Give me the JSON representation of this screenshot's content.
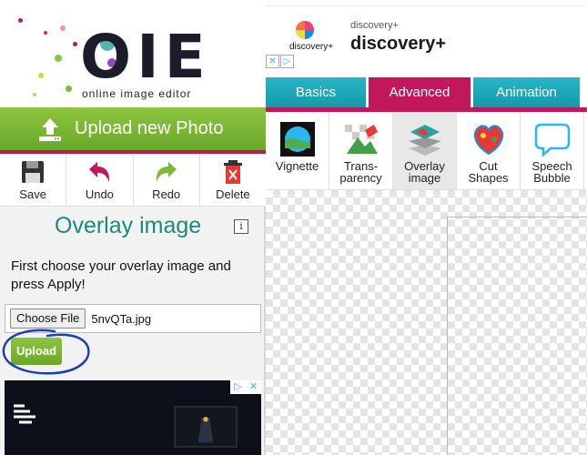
{
  "logo": {
    "letters": "OIE",
    "subtitle": "online image editor"
  },
  "upload_bar": {
    "label": "Upload new Photo"
  },
  "tools": {
    "save": "Save",
    "undo": "Undo",
    "redo": "Redo",
    "delete": "Delete"
  },
  "panel": {
    "title": "Overlay image",
    "info": "i",
    "instruction": "First choose your overlay image and press Apply!",
    "choose_file": "Choose File",
    "file_name": "5nvQTa.jpg",
    "upload": "Upload"
  },
  "ad_top": {
    "brand_small": "discovery+",
    "brand_sub": "discovery+",
    "brand_title": "discovery+"
  },
  "tabs": [
    {
      "label": "Basics"
    },
    {
      "label": "Advanced"
    },
    {
      "label": "Animation"
    }
  ],
  "right_tools": {
    "vignette": "Vignette",
    "transparency": "Trans-\nparency",
    "overlay": "Overlay\nimage",
    "cut_shapes": "Cut\nShapes",
    "speech": "Speech\nBubble"
  },
  "colors": {
    "accent_green": "#7cb937",
    "accent_pink": "#c2185b",
    "accent_teal": "#1a8a7a",
    "tab_teal": "#1fa9b8",
    "annotation_blue": "#1a3fb3"
  }
}
